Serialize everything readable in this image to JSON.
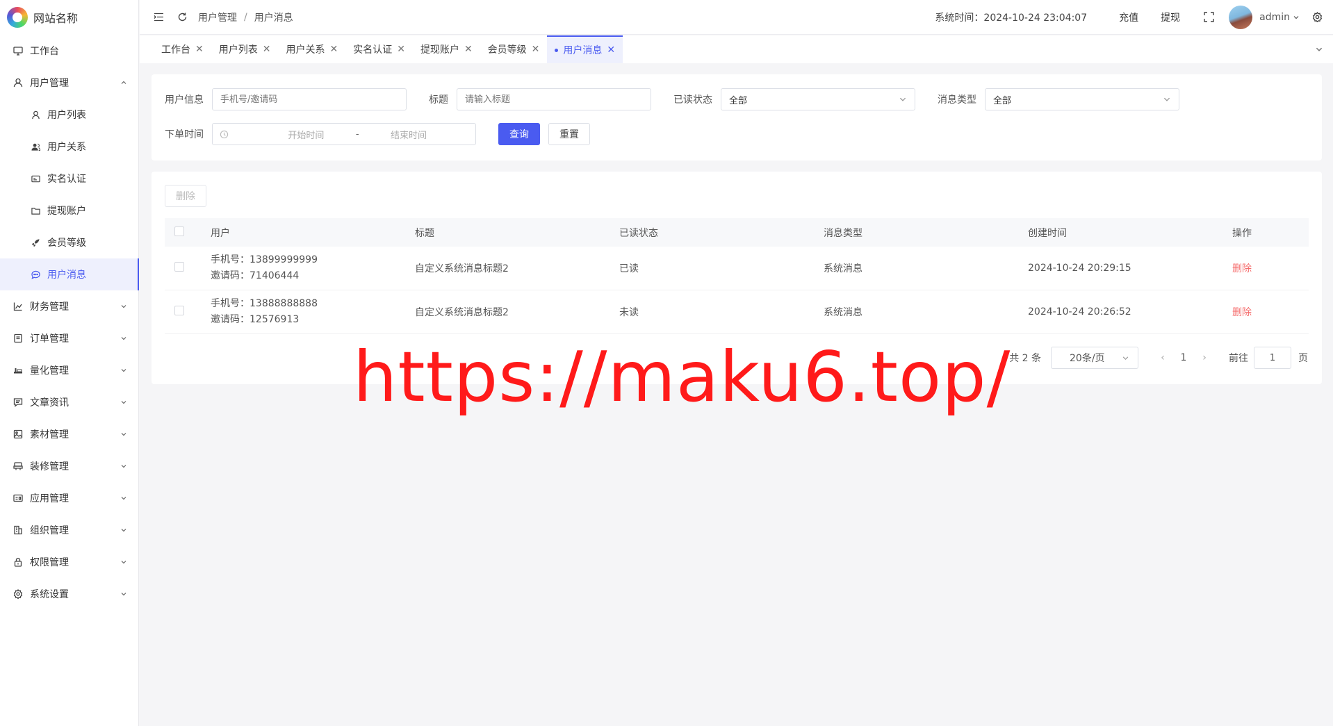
{
  "brand": {
    "name": "网站名称"
  },
  "sidebar": {
    "items": [
      {
        "label": "工作台",
        "icon": "monitor-icon"
      },
      {
        "label": "用户管理",
        "icon": "user-icon",
        "expanded": true,
        "children": [
          {
            "label": "用户列表",
            "icon": "user-outline-icon"
          },
          {
            "label": "用户关系",
            "icon": "users-icon"
          },
          {
            "label": "实名认证",
            "icon": "id-card-icon"
          },
          {
            "label": "提现账户",
            "icon": "folder-icon"
          },
          {
            "label": "会员等级",
            "icon": "rocket-icon"
          },
          {
            "label": "用户消息",
            "icon": "chat-icon",
            "active": true
          }
        ]
      },
      {
        "label": "财务管理",
        "icon": "chart-icon"
      },
      {
        "label": "订单管理",
        "icon": "order-icon"
      },
      {
        "label": "量化管理",
        "icon": "quant-icon"
      },
      {
        "label": "文章资讯",
        "icon": "message-icon"
      },
      {
        "label": "素材管理",
        "icon": "image-icon"
      },
      {
        "label": "装修管理",
        "icon": "decor-icon"
      },
      {
        "label": "应用管理",
        "icon": "app-icon"
      },
      {
        "label": "组织管理",
        "icon": "org-icon"
      },
      {
        "label": "权限管理",
        "icon": "lock-icon"
      },
      {
        "label": "系统设置",
        "icon": "gear-icon"
      }
    ]
  },
  "header": {
    "breadcrumb": [
      "用户管理",
      "用户消息"
    ],
    "breadcrumb_sep": "/",
    "system_time": "系统时间：2024-10-24 23:04:07",
    "recharge": "充值",
    "withdraw": "提现",
    "username": "admin"
  },
  "tabs": [
    {
      "label": "工作台"
    },
    {
      "label": "用户列表"
    },
    {
      "label": "用户关系"
    },
    {
      "label": "实名认证"
    },
    {
      "label": "提现账户"
    },
    {
      "label": "会员等级"
    },
    {
      "label": "用户消息",
      "active": true
    }
  ],
  "filter": {
    "user_info_label": "用户信息",
    "user_info_placeholder": "手机号/邀请码",
    "title_label": "标题",
    "title_placeholder": "请输入标题",
    "read_status_label": "已读状态",
    "read_status_value": "全部",
    "msg_type_label": "消息类型",
    "msg_type_value": "全部",
    "order_time_label": "下单时间",
    "start_placeholder": "开始时间",
    "range_sep": "-",
    "end_placeholder": "结束时间",
    "search_btn": "查询",
    "reset_btn": "重置"
  },
  "table": {
    "delete_btn": "删除",
    "columns": [
      "用户",
      "标题",
      "已读状态",
      "消息类型",
      "创建时间",
      "操作"
    ],
    "rows": [
      {
        "phone": "手机号：13899999999",
        "invite": "邀请码：71406444",
        "title": "自定义系统消息标题2",
        "read": "已读",
        "type": "系统消息",
        "created": "2024-10-24 20:29:15",
        "op": "删除"
      },
      {
        "phone": "手机号：13888888888",
        "invite": "邀请码：12576913",
        "title": "自定义系统消息标题2",
        "read": "未读",
        "type": "系统消息",
        "created": "2024-10-24 20:26:52",
        "op": "删除"
      }
    ]
  },
  "pagination": {
    "total": "共 2 条",
    "page_size": "20条/页",
    "current": "1",
    "goto": "前往",
    "jump_value": "1",
    "page_suffix": "页"
  },
  "watermark": "https://maku6.top/",
  "colors": {
    "primary": "#4a5bf0",
    "danger": "#f56c6c",
    "watermark": "#ff1a1a"
  }
}
